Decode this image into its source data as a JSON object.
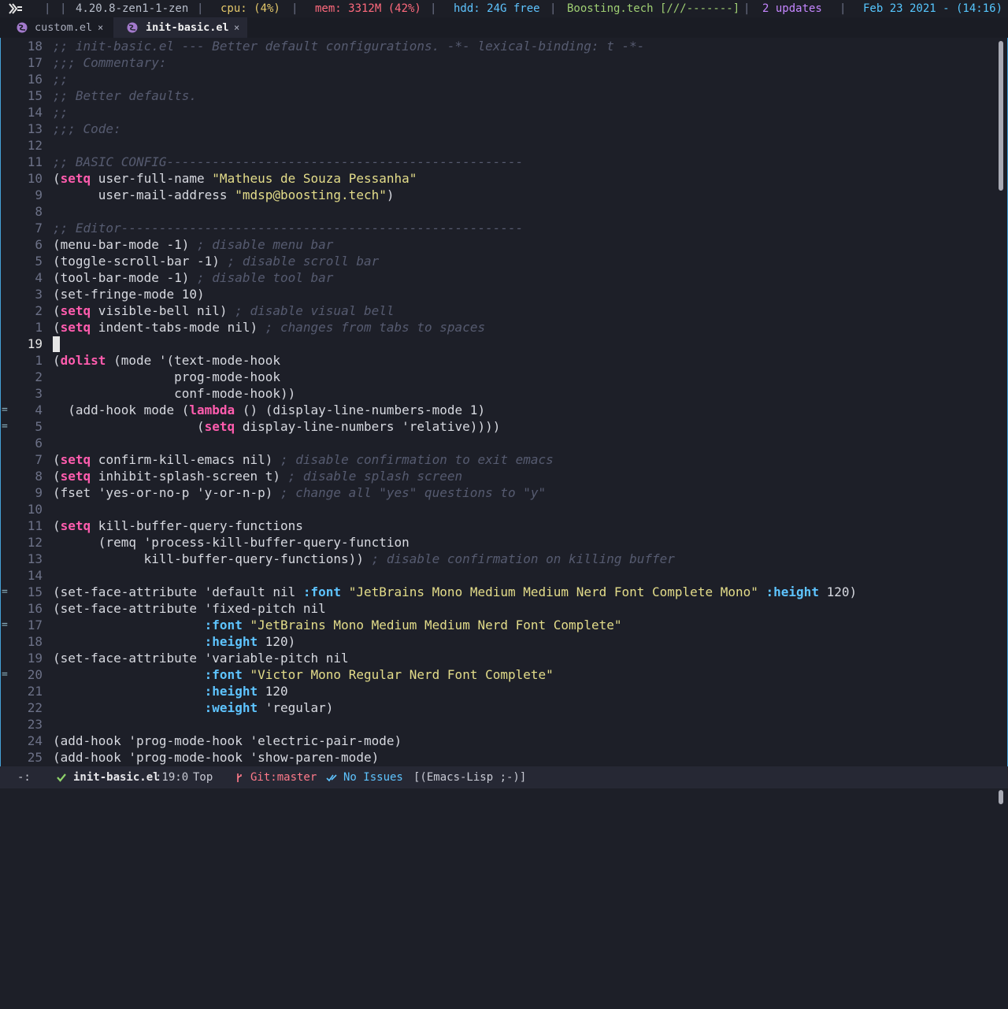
{
  "statusbar": {
    "kernel": "4.20.8-zen1-1-zen",
    "cpu": "cpu: (4%)",
    "mem": "mem: 3312M (42%)",
    "hdd": "hdd: 24G free",
    "site": "Boosting.tech [///-------]",
    "updates": "2 updates",
    "datetime": "Feb 23 2021 - (14:16)",
    "sep": "|",
    "colors": {
      "cpu": "#e4c86a",
      "mem": "#ff6a7d",
      "hdd": "#5ec4ff",
      "site": "#9fcf73",
      "updates": "#c586ff",
      "datetime": "#56c7ff"
    }
  },
  "tabs": [
    {
      "label": "custom.el",
      "close": "×",
      "active": false,
      "icon": "emacs-icon"
    },
    {
      "label": "init-basic.el",
      "close": "×",
      "active": true,
      "icon": "emacs-icon"
    }
  ],
  "editor": {
    "lines": [
      {
        "n": "18",
        "f": "",
        "t": [
          [
            "cm",
            ";; init-basic.el --- Better default configurations. -*- lexical-binding: t -*-"
          ]
        ]
      },
      {
        "n": "17",
        "f": "",
        "t": [
          [
            "cm",
            ";;; Commentary:"
          ]
        ]
      },
      {
        "n": "16",
        "f": "",
        "t": [
          [
            "cm",
            ";;"
          ]
        ]
      },
      {
        "n": "15",
        "f": "",
        "t": [
          [
            "cm",
            ";; Better defaults."
          ]
        ]
      },
      {
        "n": "14",
        "f": "",
        "t": [
          [
            "cm",
            ";;"
          ]
        ]
      },
      {
        "n": "13",
        "f": "",
        "t": [
          [
            "cm",
            ";;; Code:"
          ]
        ]
      },
      {
        "n": "12",
        "f": "",
        "t": []
      },
      {
        "n": "11",
        "f": "",
        "t": [
          [
            "cm",
            ";; BASIC CONFIG-----------------------------------------------"
          ]
        ]
      },
      {
        "n": "10",
        "f": "",
        "t": [
          [
            "pl",
            "("
          ],
          [
            "kw",
            "setq"
          ],
          [
            "pl",
            " user-full-name "
          ],
          [
            "str",
            "\"Matheus de Souza Pessanha\""
          ]
        ]
      },
      {
        "n": "9",
        "f": "",
        "t": [
          [
            "pl",
            "      user-mail-address "
          ],
          [
            "str",
            "\"mdsp@boosting.tech\""
          ],
          [
            "pl",
            ")"
          ]
        ]
      },
      {
        "n": "8",
        "f": "",
        "t": []
      },
      {
        "n": "7",
        "f": "",
        "t": [
          [
            "cm",
            ";; Editor-----------------------------------------------------"
          ]
        ]
      },
      {
        "n": "6",
        "f": "",
        "t": [
          [
            "pl",
            "(menu-bar-mode -1) "
          ],
          [
            "cm",
            "; disable menu bar"
          ]
        ]
      },
      {
        "n": "5",
        "f": "",
        "t": [
          [
            "pl",
            "(toggle-scroll-bar -1) "
          ],
          [
            "cm",
            "; disable scroll bar"
          ]
        ]
      },
      {
        "n": "4",
        "f": "",
        "t": [
          [
            "pl",
            "(tool-bar-mode -1) "
          ],
          [
            "cm",
            "; disable tool bar"
          ]
        ]
      },
      {
        "n": "3",
        "f": "",
        "t": [
          [
            "pl",
            "(set-fringe-mode 10)"
          ]
        ]
      },
      {
        "n": "2",
        "f": "",
        "t": [
          [
            "pl",
            "("
          ],
          [
            "kw",
            "setq"
          ],
          [
            "pl",
            " visible-bell nil) "
          ],
          [
            "cm",
            "; disable visual bell"
          ]
        ]
      },
      {
        "n": "1",
        "f": "",
        "t": [
          [
            "pl",
            "("
          ],
          [
            "kw",
            "setq"
          ],
          [
            "pl",
            " indent-tabs-mode nil) "
          ],
          [
            "cm",
            "; changes from tabs to spaces"
          ]
        ]
      },
      {
        "n": "19",
        "f": "",
        "cur": true,
        "t": []
      },
      {
        "n": "1",
        "f": "",
        "t": [
          [
            "pl",
            "("
          ],
          [
            "kw",
            "dolist"
          ],
          [
            "pl",
            " (mode '(text-mode-hook"
          ]
        ]
      },
      {
        "n": "2",
        "f": "",
        "t": [
          [
            "pl",
            "                prog-mode-hook"
          ]
        ]
      },
      {
        "n": "3",
        "f": "",
        "t": [
          [
            "pl",
            "                conf-mode-hook))"
          ]
        ]
      },
      {
        "n": "4",
        "f": "=",
        "t": [
          [
            "pl",
            "  (add-hook mode ("
          ],
          [
            "kw",
            "lambda"
          ],
          [
            "pl",
            " () (display-line-numbers-mode 1)"
          ]
        ]
      },
      {
        "n": "5",
        "f": "=",
        "t": [
          [
            "pl",
            "                   ("
          ],
          [
            "kw",
            "setq"
          ],
          [
            "pl",
            " display-line-numbers 'relative))))"
          ]
        ]
      },
      {
        "n": "6",
        "f": "",
        "t": []
      },
      {
        "n": "7",
        "f": "",
        "t": [
          [
            "pl",
            "("
          ],
          [
            "kw",
            "setq"
          ],
          [
            "pl",
            " confirm-kill-emacs nil) "
          ],
          [
            "cm",
            "; disable confirmation to exit emacs"
          ]
        ]
      },
      {
        "n": "8",
        "f": "",
        "t": [
          [
            "pl",
            "("
          ],
          [
            "kw",
            "setq"
          ],
          [
            "pl",
            " inhibit-splash-screen t) "
          ],
          [
            "cm",
            "; disable splash screen"
          ]
        ]
      },
      {
        "n": "9",
        "f": "",
        "t": [
          [
            "pl",
            "(fset 'yes-or-no-p 'y-or-n-p) "
          ],
          [
            "cm",
            "; change all \"yes\" questions to \"y\""
          ]
        ]
      },
      {
        "n": "10",
        "f": "",
        "t": []
      },
      {
        "n": "11",
        "f": "",
        "t": [
          [
            "pl",
            "("
          ],
          [
            "kw",
            "setq"
          ],
          [
            "pl",
            " kill-buffer-query-functions"
          ]
        ]
      },
      {
        "n": "12",
        "f": "",
        "t": [
          [
            "pl",
            "      (remq 'process-kill-buffer-query-function"
          ]
        ]
      },
      {
        "n": "13",
        "f": "",
        "t": [
          [
            "pl",
            "            kill-buffer-query-functions)) "
          ],
          [
            "cm",
            "; disable confirmation on killing buffer"
          ]
        ]
      },
      {
        "n": "14",
        "f": "",
        "t": []
      },
      {
        "n": "15",
        "f": "=",
        "t": [
          [
            "pl",
            "(set-face-attribute 'default nil "
          ],
          [
            "key",
            ":font"
          ],
          [
            "pl",
            " "
          ],
          [
            "str",
            "\"JetBrains Mono Medium Medium Nerd Font Complete Mono\""
          ],
          [
            "pl",
            " "
          ],
          [
            "key",
            ":height"
          ],
          [
            "pl",
            " 120)"
          ]
        ]
      },
      {
        "n": "16",
        "f": "",
        "t": [
          [
            "pl",
            "(set-face-attribute 'fixed-pitch nil"
          ]
        ]
      },
      {
        "n": "17",
        "f": "=",
        "t": [
          [
            "pl",
            "                    "
          ],
          [
            "key",
            ":font"
          ],
          [
            "pl",
            " "
          ],
          [
            "str",
            "\"JetBrains Mono Medium Medium Nerd Font Complete\""
          ]
        ]
      },
      {
        "n": "18",
        "f": "",
        "t": [
          [
            "pl",
            "                    "
          ],
          [
            "key",
            ":height"
          ],
          [
            "pl",
            " 120)"
          ]
        ]
      },
      {
        "n": "19",
        "f": "",
        "t": [
          [
            "pl",
            "(set-face-attribute 'variable-pitch nil"
          ]
        ]
      },
      {
        "n": "20",
        "f": "=",
        "t": [
          [
            "pl",
            "                    "
          ],
          [
            "key",
            ":font"
          ],
          [
            "pl",
            " "
          ],
          [
            "str",
            "\"Victor Mono Regular Nerd Font Complete\""
          ]
        ]
      },
      {
        "n": "21",
        "f": "",
        "t": [
          [
            "pl",
            "                    "
          ],
          [
            "key",
            ":height"
          ],
          [
            "pl",
            " 120"
          ]
        ]
      },
      {
        "n": "22",
        "f": "",
        "t": [
          [
            "pl",
            "                    "
          ],
          [
            "key",
            ":weight"
          ],
          [
            "pl",
            " 'regular)"
          ]
        ]
      },
      {
        "n": "23",
        "f": "",
        "t": []
      },
      {
        "n": "24",
        "f": "",
        "t": [
          [
            "pl",
            "(add-hook 'prog-mode-hook 'electric-pair-mode)"
          ]
        ]
      },
      {
        "n": "25",
        "f": "",
        "t": [
          [
            "pl",
            "(add-hook 'prog-mode-hook 'show-paren-mode)"
          ]
        ]
      }
    ]
  },
  "modeline": {
    "state": "-:",
    "check_icon": "check-icon",
    "filename": "init-basic.el",
    "position": ":19:0",
    "scroll": "Top",
    "branch_icon": "git-branch-icon",
    "vcs": "Git:master",
    "flycheck_icon": "checkmark-icon",
    "issues": "No Issues",
    "major_mode": "[(Emacs-Lisp ;-)]",
    "colors": {
      "ok": "#8fd36a",
      "vcs": "#ff7a8a",
      "issues": "#5ec4ff"
    }
  }
}
